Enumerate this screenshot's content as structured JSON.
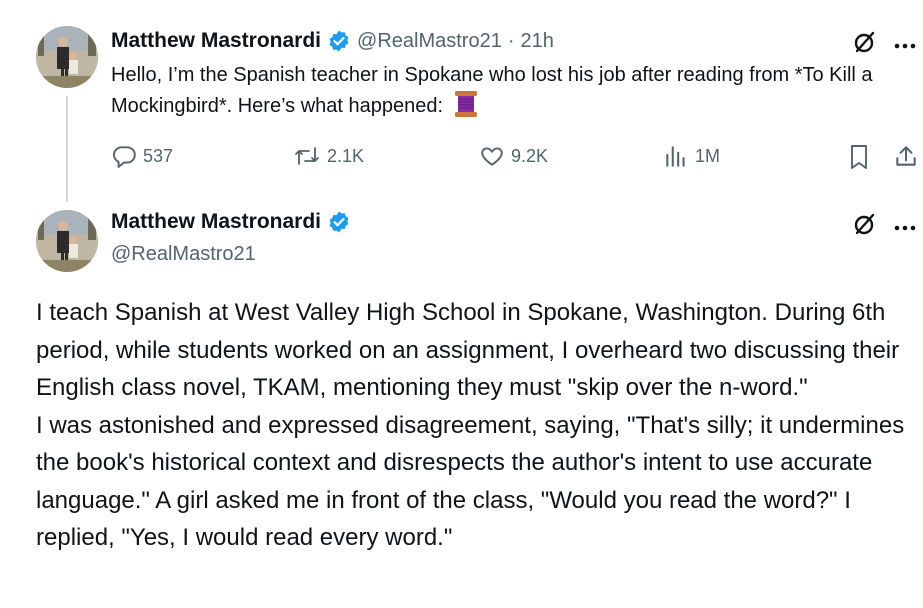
{
  "tweet1": {
    "author_name": "Matthew Mastronardi",
    "handle": "@RealMastro21",
    "separator": "·",
    "time": "21h",
    "text": "Hello, I’m the Spanish teacher in Spokane who lost his job after reading from *To Kill a Mockingbird*. Here’s what happened:",
    "emoji_icon": "spool-of-thread-icon",
    "actions": {
      "replies": "537",
      "retweets": "2.1K",
      "likes": "9.2K",
      "views": "1M"
    }
  },
  "tweet2": {
    "author_name": "Matthew Mastronardi",
    "handle": "@RealMastro21",
    "paragraphs": [
      "I teach Spanish at West Valley High School in Spokane, Washington. During 6th period, while students worked on an assignment, I overheard two discussing their English class novel, TKAM, mentioning they must \"skip over the n-word.\"",
      "I was astonished and expressed disagreement, saying, \"That's silly; it undermines the book's historical context and disrespects the author's intent to use accurate language.\" A girl asked me in front of the class, \"Would you read the word?\" I replied, \"Yes, I would read every word.\""
    ]
  },
  "colors": {
    "verified_blue": "#1d9bf0",
    "secondary_text": "#536471",
    "primary_text": "#0f1419",
    "thread_line": "#cfd9de"
  }
}
